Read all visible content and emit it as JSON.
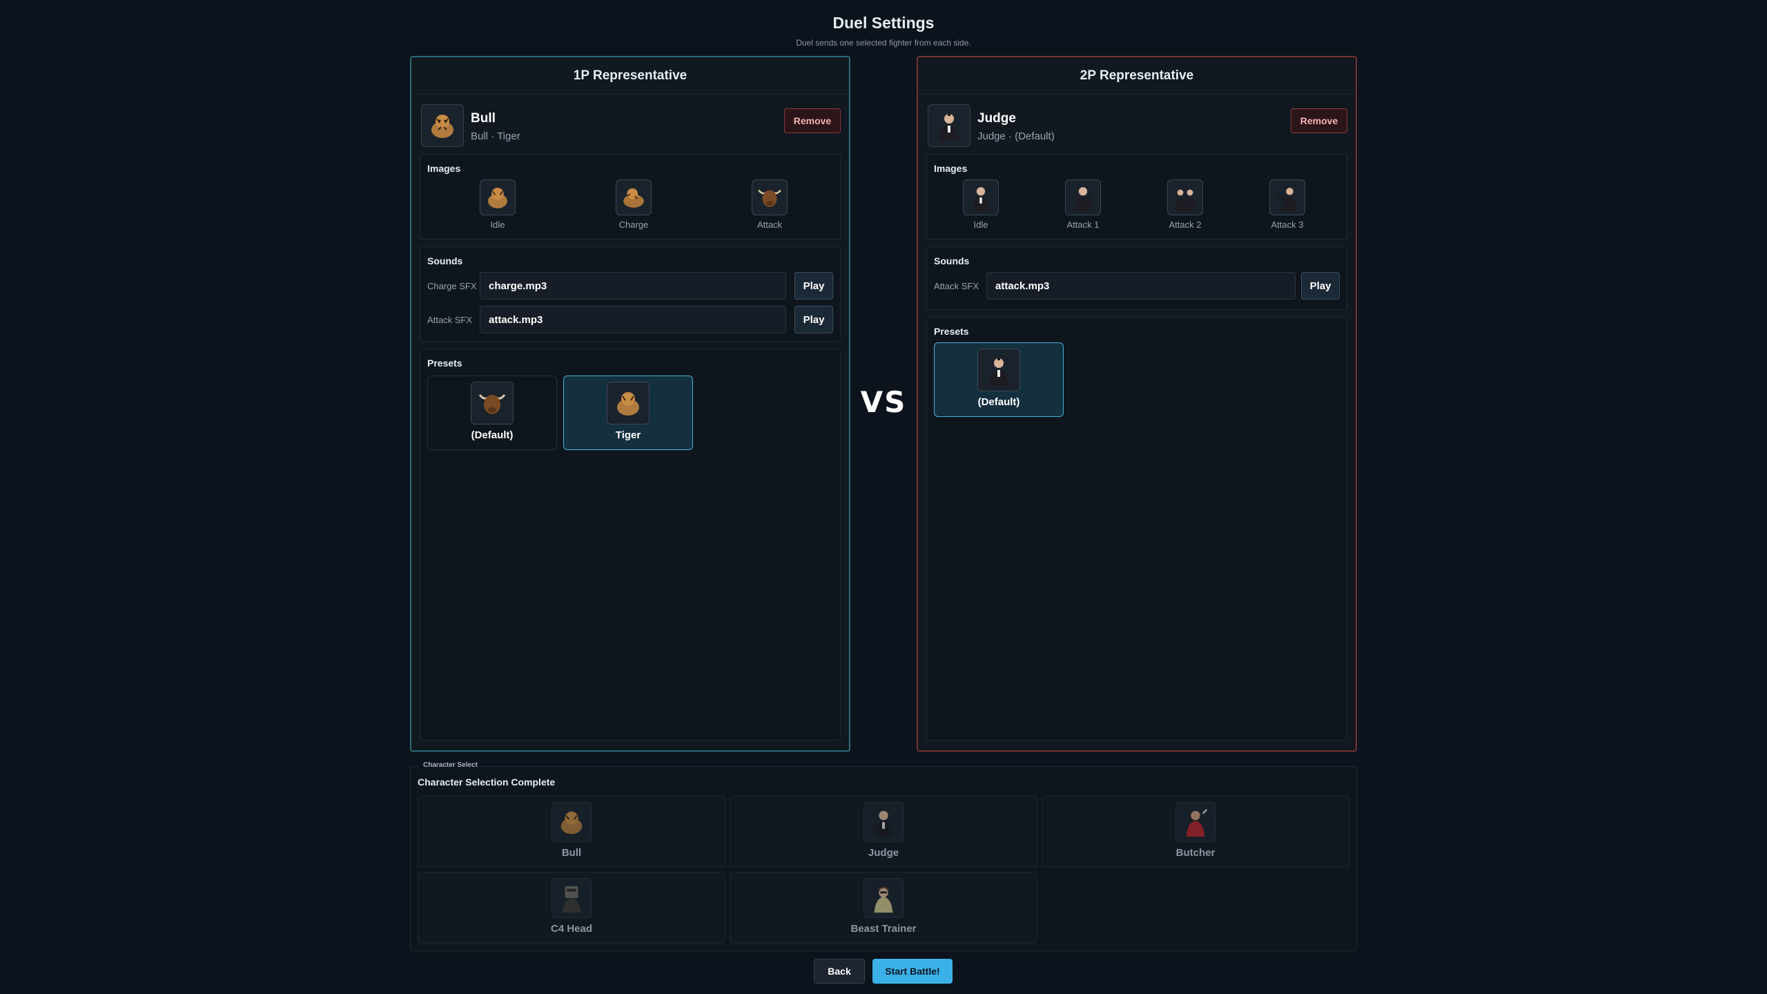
{
  "header": {
    "title": "Duel Settings",
    "subtitle": "Duel sends one selected fighter from each side."
  },
  "vs_label": "VS",
  "player1": {
    "panel_title": "1P Representative",
    "name": "Bull",
    "subtitle": "Bull · Tiger",
    "avatar_icon": "tiger-icon",
    "remove_label": "Remove",
    "images_label": "Images",
    "images": [
      {
        "label": "Idle",
        "icon": "tiger-icon"
      },
      {
        "label": "Charge",
        "icon": "tiger-icon"
      },
      {
        "label": "Attack",
        "icon": "bull-icon"
      }
    ],
    "sounds_label": "Sounds",
    "sounds": [
      {
        "label": "Charge SFX",
        "file": "charge.mp3",
        "play_label": "Play"
      },
      {
        "label": "Attack SFX",
        "file": "attack.mp3",
        "play_label": "Play"
      }
    ],
    "presets_label": "Presets",
    "presets": [
      {
        "name": "(Default)",
        "icon": "bull-icon",
        "selected": false
      },
      {
        "name": "Tiger",
        "icon": "tiger-icon",
        "selected": true
      }
    ]
  },
  "player2": {
    "panel_title": "2P Representative",
    "name": "Judge",
    "subtitle": "Judge · (Default)",
    "avatar_icon": "judge-icon",
    "remove_label": "Remove",
    "images_label": "Images",
    "images": [
      {
        "label": "Idle",
        "icon": "judge-icon"
      },
      {
        "label": "Attack 1",
        "icon": "judge-icon"
      },
      {
        "label": "Attack 2",
        "icon": "judge-icon"
      },
      {
        "label": "Attack 3",
        "icon": "judge-icon"
      }
    ],
    "sounds_label": "Sounds",
    "sounds": [
      {
        "label": "Attack SFX",
        "file": "attack.mp3",
        "play_label": "Play"
      }
    ],
    "presets_label": "Presets",
    "presets": [
      {
        "name": "(Default)",
        "icon": "judge-icon",
        "selected": true
      }
    ]
  },
  "character_select": {
    "legend": "Character Select",
    "status": "Character Selection Complete",
    "characters": [
      {
        "name": "Bull",
        "icon": "bull-icon"
      },
      {
        "name": "Judge",
        "icon": "judge-icon"
      },
      {
        "name": "Butcher",
        "icon": "butcher-icon"
      },
      {
        "name": "C4 Head",
        "icon": "c4-head-icon"
      },
      {
        "name": "Beast Trainer",
        "icon": "beast-trainer-icon"
      }
    ]
  },
  "footer": {
    "back_label": "Back",
    "start_label": "Start Battle!"
  },
  "colors": {
    "background": "#0d131c",
    "p1_border": "#2e6a78",
    "p2_border": "#74332f",
    "accent": "#3cb1e8",
    "remove": "#8b3a3a"
  }
}
